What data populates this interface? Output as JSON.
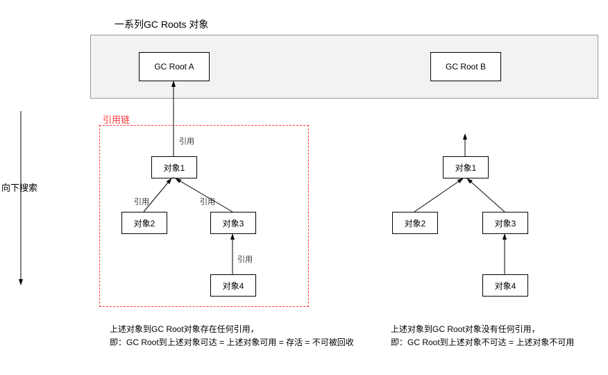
{
  "title": "一系列GC Roots 对象",
  "sideLabel": "向下搜索",
  "refChainLabel": "引用链",
  "nodes": {
    "gcRootA": "GC Root A",
    "gcRootB": "GC Root B",
    "obj1": "对象1",
    "obj2": "对象2",
    "obj3": "对象3",
    "obj4": "对象4"
  },
  "edgeLabel": "引用",
  "captions": {
    "left": {
      "line1": "上述对象到GC Root对象存在任何引用，",
      "line2": "即：GC Root到上述对象可达 = 上述对象可用 = 存活 = 不可被回收"
    },
    "right": {
      "line1": "上述对象到GC Root对象没有任何引用，",
      "line2": "即：GC Root到上述对象不可达 = 上述对象不可用"
    }
  }
}
